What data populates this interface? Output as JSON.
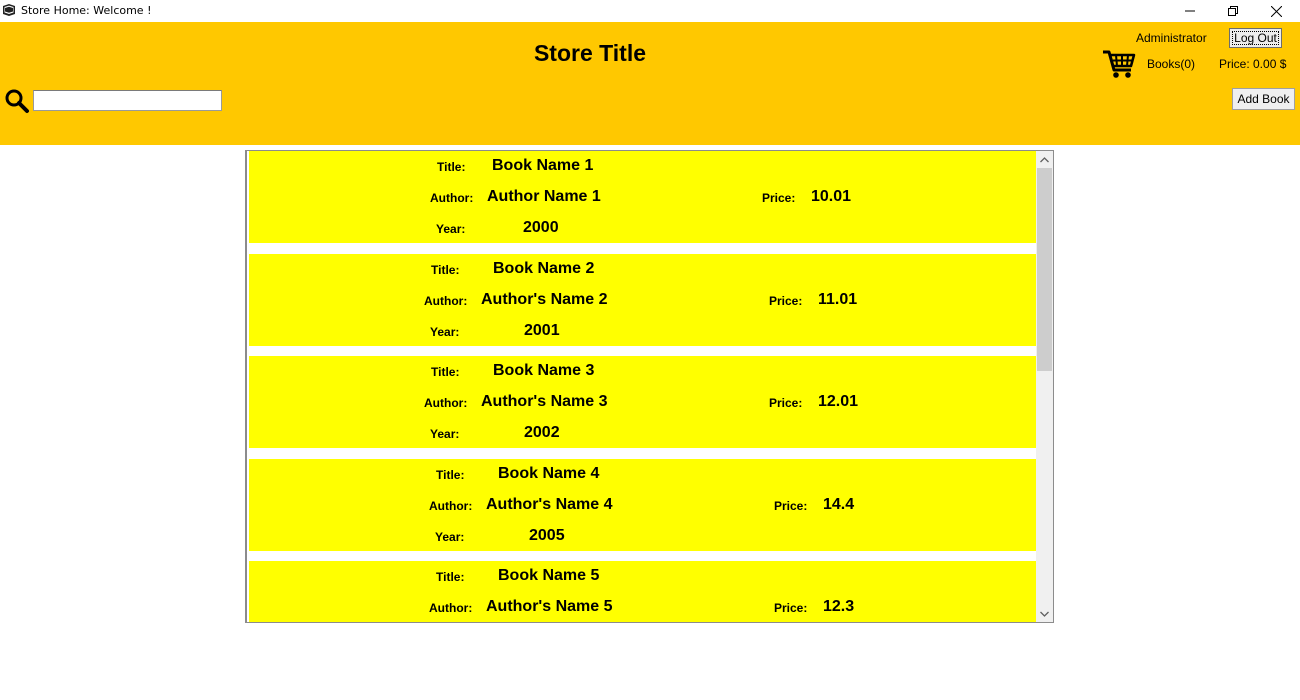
{
  "window": {
    "title": "Store Home: Welcome !",
    "icon": "book-icon"
  },
  "header": {
    "store_title": "Store Title",
    "background_color": "#ffc800",
    "search": {
      "value": "",
      "placeholder": ""
    },
    "user_name": "Administrator",
    "logout_label": "Log Out",
    "cart": {
      "books_label": "Books(0)",
      "price_label": "Price: 0.00 $",
      "icon": "shopping-cart-icon"
    },
    "add_book_label": "Add Book"
  },
  "labels": {
    "title": "Title:",
    "author": "Author:",
    "year": "Year:",
    "price": "Price:"
  },
  "books": [
    {
      "title": "Book Name 1",
      "author": "Author Name 1",
      "year": "2000",
      "price": "10.01"
    },
    {
      "title": "Book Name 2",
      "author": "Author's Name 2",
      "year": "2001",
      "price": "11.01"
    },
    {
      "title": "Book Name 3",
      "author": "Author's Name 3",
      "year": "2002",
      "price": "12.01"
    },
    {
      "title": "Book Name 4",
      "author": "Author's Name 4",
      "year": "2005",
      "price": "14.4"
    },
    {
      "title": "Book Name 5",
      "author": "Author's Name 5",
      "year": "",
      "price": "12.3"
    }
  ],
  "row_color": "#ffff00"
}
